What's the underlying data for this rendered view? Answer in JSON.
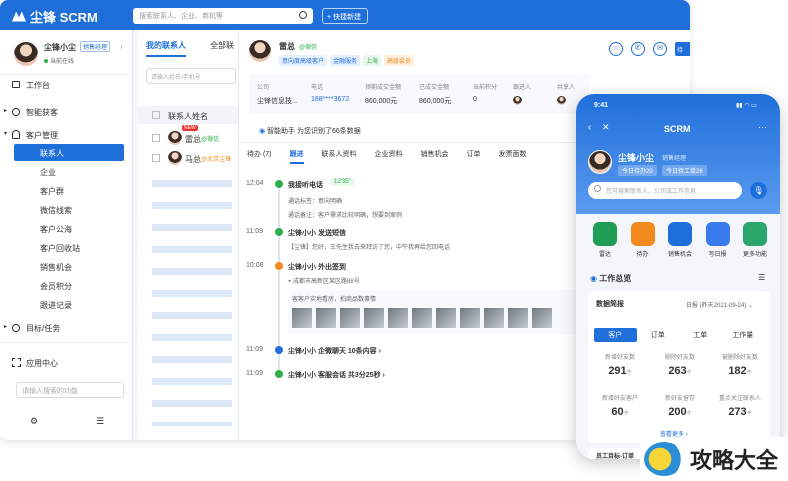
{
  "topbar": {
    "logo": "尘锋 SCRM",
    "search_placeholder": "搜索联系人、企业、商机等",
    "new_button": "+ 快捷新建"
  },
  "profile": {
    "name": "尘锋小尘",
    "badge": "销售经理",
    "status": "当前在线"
  },
  "sidebar": {
    "items": [
      {
        "label": "工作台",
        "level": "top"
      },
      {
        "label": "智能获客",
        "level": "top"
      },
      {
        "label": "客户管理",
        "level": "top"
      },
      {
        "label": "联系人",
        "level": "sub",
        "active": true
      },
      {
        "label": "企业",
        "level": "sub"
      },
      {
        "label": "客户群",
        "level": "sub"
      },
      {
        "label": "微信线索",
        "level": "sub"
      },
      {
        "label": "客户公海",
        "level": "sub"
      },
      {
        "label": "客户回收站",
        "level": "sub"
      },
      {
        "label": "销售机会",
        "level": "sub"
      },
      {
        "label": "会员积分",
        "level": "sub"
      },
      {
        "label": "跟进记录",
        "level": "sub"
      },
      {
        "label": "目标/任务",
        "level": "top"
      },
      {
        "label": "应用中心",
        "level": "top"
      }
    ],
    "search_placeholder": "请输入搜索的功能"
  },
  "list": {
    "tabs": [
      "我的联系人",
      "全部联"
    ],
    "search_placeholder": "请输入姓名/手机号",
    "column": "联系人姓名",
    "rows": [
      {
        "name": "雷总",
        "tag": "@微信",
        "badge": "NEW"
      },
      {
        "name": "马总",
        "tag": "@北京尘锋"
      }
    ]
  },
  "contact": {
    "name": "雷总",
    "channel": "@微信",
    "tags": [
      "意向度高级客户",
      "金融服务",
      "上海",
      "高级会员"
    ],
    "columns": [
      "公司",
      "电话",
      "预期成交金额",
      "已成交金额",
      "当前积分",
      "跟进人",
      "共享人"
    ],
    "values": [
      "尘锋信息技...",
      "188****3672",
      "860,000元",
      "860,000元",
      "0",
      "",
      ""
    ],
    "assistant": "智能助手 为您识别了66条数据",
    "tabs": [
      "待办 (7)",
      "跟进",
      "联系人资料",
      "企业资料",
      "销售机会",
      "订单",
      "发票面数"
    ],
    "actions": [
      "待"
    ]
  },
  "timeline": [
    {
      "time": "12:04",
      "title": "我接听电话",
      "extra": "12'35\"",
      "lines": [
        "通话标签：意向明确",
        "通话备注：客户需求比较明确，想要到案例"
      ]
    },
    {
      "time": "11:09",
      "title": "尘锋小小 发送短信",
      "lines": [
        "【尘锋】您好，王先生我去来拜访了您，中午我再给您回电话"
      ]
    },
    {
      "time": "10:08",
      "title": "尘锋小小 外出签到",
      "lines": [
        "成都市高新区某区路88号",
        "客客户实地看房，拍商品数事情"
      ]
    },
    {
      "time": "11:09",
      "title": "尘锋小小 企微聊天 10条内容 ›",
      "lines": []
    },
    {
      "time": "11:09",
      "title": "尘锋小小 客服会话 共3分25秒 ›",
      "lines": []
    }
  ],
  "phone": {
    "time": "9:41",
    "title": "SCRM",
    "name": "尘锋小尘",
    "role": "销售经理",
    "stat1": "今日待办20",
    "stat2": "今日待工单26",
    "search_placeholder": "您可搜索联系人、公司或工作信息",
    "icons": [
      {
        "label": "雷达",
        "color": "#1f9d55"
      },
      {
        "label": "待办",
        "color": "#f28a1e"
      },
      {
        "label": "销售机会",
        "color": "#1f6fdb"
      },
      {
        "label": "写日报",
        "color": "#3a7bf0"
      },
      {
        "label": "更多功能",
        "color": "#2aa56b"
      }
    ],
    "section": "工作总览",
    "card_title": "数据简报",
    "card_range": "日报 (昨天2021-09-24) ⌄",
    "tabs": [
      "客户",
      "订单",
      "工单",
      "工作量"
    ],
    "stats": [
      {
        "label": "新增好友数",
        "value": "291",
        "unit": "个"
      },
      {
        "label": "删除好友数",
        "value": "263",
        "unit": "个"
      },
      {
        "label": "被删除好友数",
        "value": "182",
        "unit": "个"
      },
      {
        "label": "新增好友客户",
        "value": "60",
        "unit": "个"
      },
      {
        "label": "新好友留存",
        "value": "200",
        "unit": "个"
      },
      {
        "label": "重点关注联系人",
        "value": "273",
        "unit": "个"
      }
    ],
    "more": "查看更多 ›",
    "footer": "员工目标-订单"
  },
  "watermark": "攻略大全"
}
